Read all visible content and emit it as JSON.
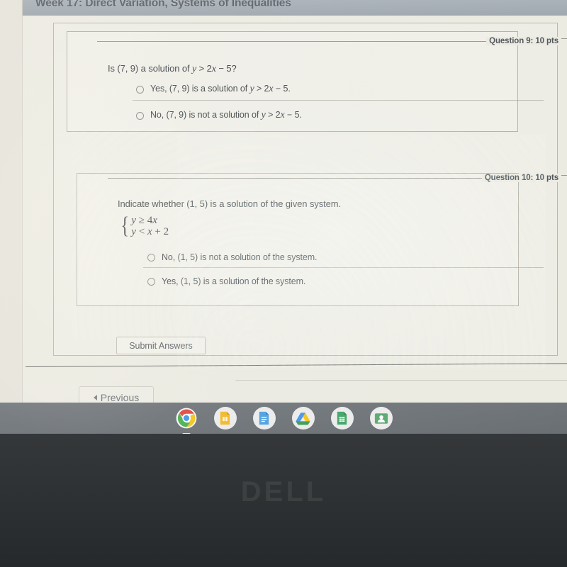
{
  "header": {
    "title": "Week 17: Direct Variation, Systems of Inequalities"
  },
  "questions": [
    {
      "legend": "Question 9: 10 pts",
      "prompt_parts": {
        "a": "Is (7, 9) a solution of ",
        "y": "y",
        "b": " > 2",
        "x": "x",
        "c": " − 5?"
      },
      "options": [
        {
          "a": "Yes, (7, 9) is a solution of ",
          "y": "y",
          "b": " > 2",
          "x": "x",
          "c": " − 5."
        },
        {
          "a": "No, (7, 9) is not a solution of ",
          "y": "y",
          "b": " > 2",
          "x": "x",
          "c": " − 5."
        }
      ]
    },
    {
      "legend": "Question 10: 10 pts",
      "prompt": "Indicate whether (1, 5) is a solution of the given system.",
      "system": {
        "brace": "{",
        "row1_var": "y",
        "row1_rel": " ≥ 4",
        "row1_var2": "x",
        "row2_var": "y",
        "row2_rel": " < ",
        "row2_var2": "x",
        "row2_tail": " + 2"
      },
      "options": [
        {
          "text": "No, (1, 5) is not a solution of the system."
        },
        {
          "text": "Yes, (1, 5) is a solution of the system."
        }
      ]
    }
  ],
  "buttons": {
    "submit": "Submit Answers",
    "previous": "Previous",
    "previous_arrow": "left-triangle-icon"
  },
  "shelf": {
    "items": [
      {
        "name": "chrome-icon",
        "label": "Chrome",
        "active": true
      },
      {
        "name": "google-keep-icon",
        "label": "Keep",
        "active": false
      },
      {
        "name": "google-docs-icon",
        "label": "Docs",
        "active": false
      },
      {
        "name": "google-drive-icon",
        "label": "Drive",
        "active": false
      },
      {
        "name": "google-sheets-icon",
        "label": "Sheets",
        "active": false
      },
      {
        "name": "google-contacts-icon",
        "label": "Contacts",
        "active": false
      }
    ]
  },
  "device": {
    "brand": "DELL"
  },
  "colors": {
    "header_bar": "#a6aeb5",
    "page_background": "#ecebe2",
    "shelf": "#6d7277",
    "bezel": "#303335",
    "text": "#3f4347",
    "border": "#b5b2a8"
  }
}
